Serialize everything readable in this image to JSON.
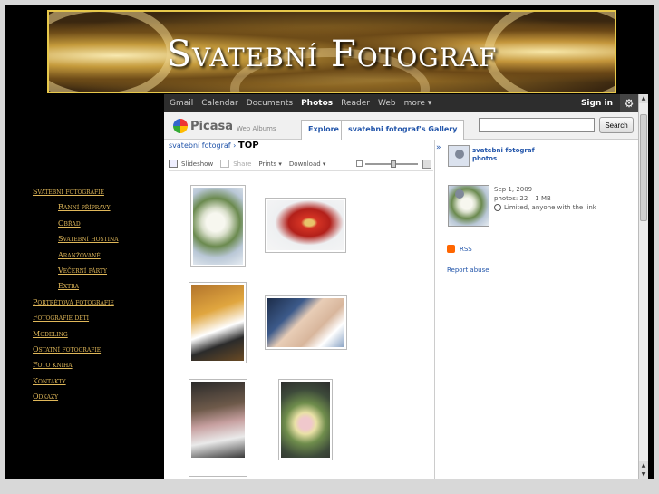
{
  "banner": {
    "title": "Svatební Fotograf"
  },
  "menu": {
    "items": [
      {
        "label": "Svatební fotografie",
        "sub": false
      },
      {
        "label": "Ranní přípravy",
        "sub": true
      },
      {
        "label": "Obřad",
        "sub": true
      },
      {
        "label": "Svatební hostina",
        "sub": true
      },
      {
        "label": "Aranžované",
        "sub": true
      },
      {
        "label": "Večerní párty",
        "sub": true
      },
      {
        "label": "Extra",
        "sub": true
      },
      {
        "label": "Portrétová fotografie",
        "sub": false
      },
      {
        "label": "Fotografie dětí",
        "sub": false
      },
      {
        "label": "Modeling",
        "sub": false
      },
      {
        "label": "Ostatní fotografie",
        "sub": false
      },
      {
        "label": "Foto kniha",
        "sub": false
      },
      {
        "label": "Kontakty",
        "sub": false
      },
      {
        "label": "Odkazy",
        "sub": false
      }
    ]
  },
  "gbar": {
    "links": [
      "Gmail",
      "Calendar",
      "Documents",
      "Photos",
      "Reader",
      "Web",
      "more ▾"
    ],
    "active": "Photos",
    "signin": "Sign in"
  },
  "picasa": {
    "logo": "Picasa",
    "logo_sub": "Web Albums",
    "tab_explore": "Explore",
    "tab_gallery": "svatebni fotograf's Gallery",
    "search_placeholder": "",
    "search_button": "Search"
  },
  "album": {
    "crumb_link": "svatební fotograf",
    "crumb_sep": "›",
    "title": "TOP",
    "toolbar": {
      "slideshow": "Slideshow",
      "share": "Share",
      "prints": "Prints ▾",
      "download": "Download ▾"
    }
  },
  "side": {
    "owner": "svatebni fotograf",
    "owner_photos": "photos",
    "date": "Sep 1, 2009",
    "photos_count": "photos: 22 – 1 MB",
    "visibility": "Limited, anyone with the link",
    "rss": "RSS",
    "report": "Report abuse"
  },
  "colors": {
    "menu_link": "#e0b85a",
    "picasa_link": "#2255aa",
    "banner_border": "#e7c84b"
  }
}
